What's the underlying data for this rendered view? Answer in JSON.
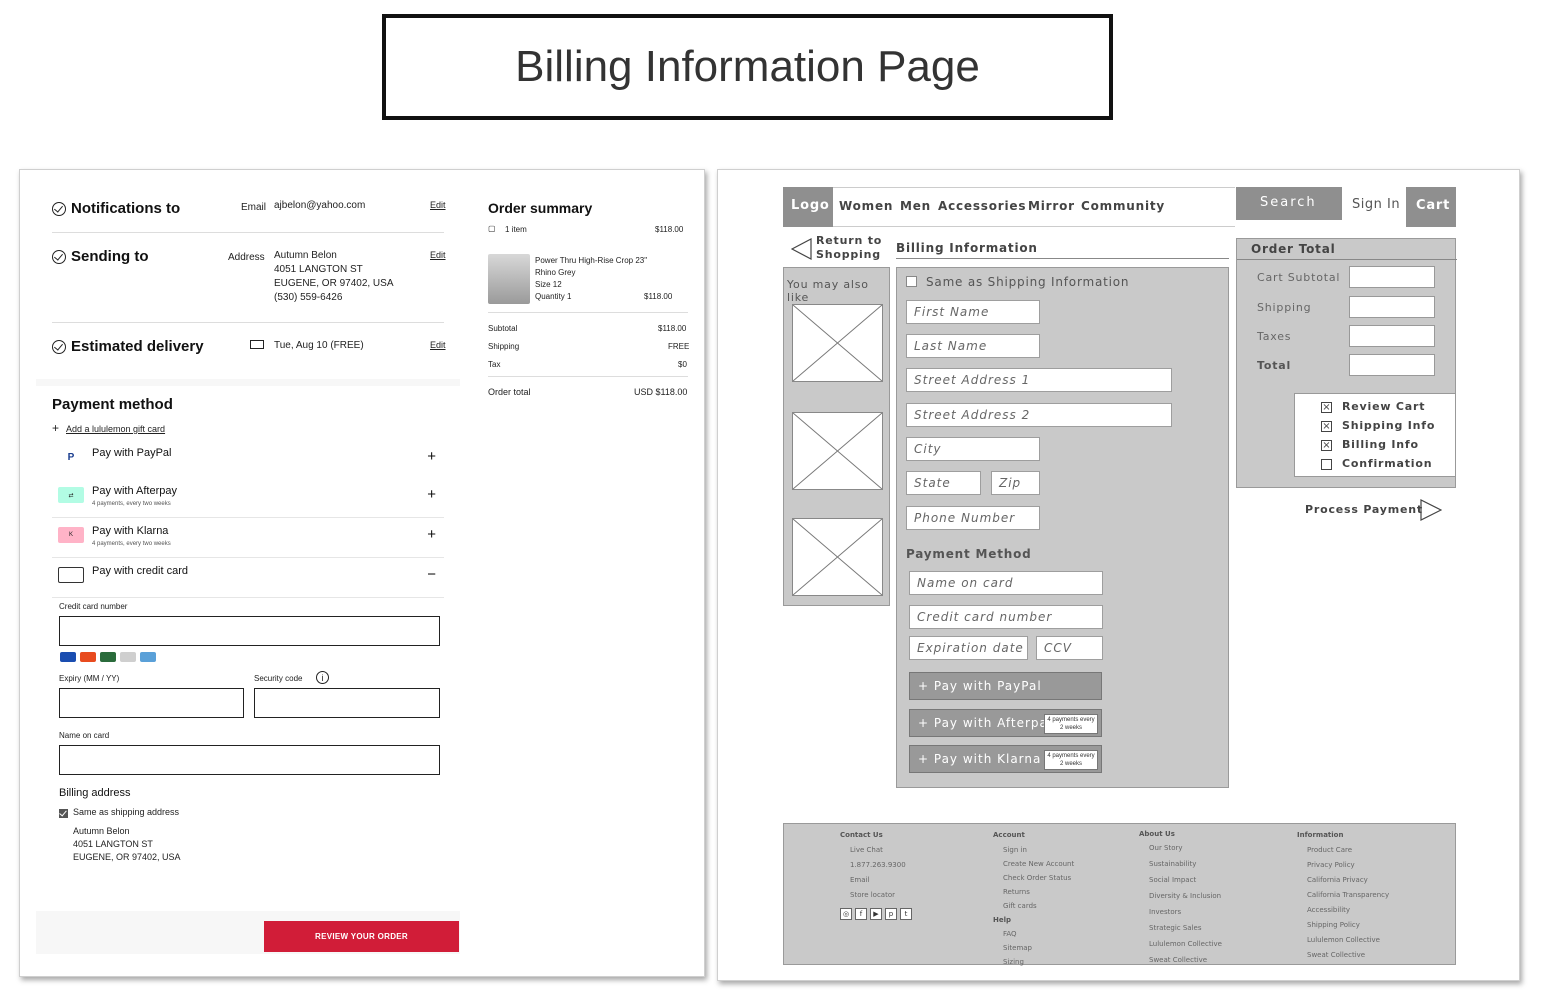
{
  "page_title": "Billing Information Page",
  "left": {
    "notifications": {
      "title": "Notifications to",
      "label": "Email",
      "value": "ajbelon@yahoo.com",
      "edit": "Edit"
    },
    "sending": {
      "title": "Sending to",
      "label": "Address",
      "lines": [
        "Autumn Belon",
        "4051 LANGTON ST",
        "EUGENE, OR 97402, USA",
        "(530) 559-6426"
      ],
      "edit": "Edit"
    },
    "delivery": {
      "title": "Estimated delivery",
      "value": "Tue, Aug 10 (FREE)",
      "edit": "Edit"
    },
    "payment": {
      "title": "Payment method",
      "gift": "Add a lululemon gift card",
      "options": [
        {
          "label": "Pay with PayPal",
          "sub": "",
          "toggle": "+"
        },
        {
          "label": "Pay with Afterpay",
          "sub": "4 payments, every two weeks",
          "toggle": "+"
        },
        {
          "label": "Pay with Klarna",
          "sub": "4 payments, every two weeks",
          "toggle": "+"
        },
        {
          "label": "Pay with credit card",
          "sub": "",
          "toggle": "−"
        }
      ],
      "cc_label": "Credit card number",
      "expiry_label": "Expiry (MM / YY)",
      "security_label": "Security code",
      "name_label": "Name on card"
    },
    "billing": {
      "title": "Billing address",
      "same": "Same as shipping address",
      "lines": [
        "Autumn Belon",
        "4051 LANGTON ST",
        "EUGENE, OR 97402, USA"
      ]
    },
    "review_button": "REVIEW YOUR ORDER",
    "order_summary": {
      "title": "Order summary",
      "items_count": "1 item",
      "total_top": "$118.00",
      "item": {
        "name": "Power Thru High-Rise Crop 23\"",
        "color": "Rhino Grey",
        "size": "Size 12",
        "qty": "Quantity 1",
        "price": "$118.00"
      },
      "rows": [
        {
          "label": "Subtotal",
          "value": "$118.00"
        },
        {
          "label": "Shipping",
          "value": "FREE"
        },
        {
          "label": "Tax",
          "value": "$0"
        }
      ],
      "order_total_label": "Order total",
      "order_total_value": "USD $118.00"
    }
  },
  "right": {
    "nav": {
      "logo": "Logo",
      "links": [
        "Women",
        "Men",
        "Accessories",
        "Mirror",
        "Community"
      ],
      "search": "Search",
      "signin": "Sign In",
      "cart": "Cart"
    },
    "return": [
      "Return to",
      "Shopping"
    ],
    "billing_header": "Billing Information",
    "also_like": "You may also like",
    "same_shipping": "Same as Shipping Information",
    "fields": {
      "first": "First Name",
      "last": "Last Name",
      "street1": "Street Address 1",
      "street2": "Street Address 2",
      "city": "City",
      "state": "State",
      "zip": "Zip",
      "phone": "Phone Number"
    },
    "payment_method": "Payment Method",
    "pay_fields": {
      "name": "Name on card",
      "cc": "Credit card number",
      "exp": "Expiration date",
      "ccv": "CCV"
    },
    "pay_buttons": [
      {
        "label": "+ Pay with PayPal",
        "tag": ""
      },
      {
        "label": "+ Pay with Afterpay",
        "tag": "4 payments every 2 weeks"
      },
      {
        "label": "+ Pay with Klarna",
        "tag": "4 payments every 2 weeks"
      }
    ],
    "order_total": {
      "title": "Order Total",
      "rows": [
        "Cart Subtotal",
        "Shipping",
        "Taxes",
        "Total"
      ]
    },
    "steps": [
      {
        "label": "Review Cart",
        "checked": true
      },
      {
        "label": "Shipping Info",
        "checked": true
      },
      {
        "label": "Billing Info",
        "checked": true
      },
      {
        "label": "Confirmation",
        "checked": false
      }
    ],
    "process_payment": "Process Payment",
    "footer": {
      "contact": {
        "title": "Contact Us",
        "items": [
          "Live Chat",
          "1.877.263.9300",
          "Email",
          "Store locator"
        ]
      },
      "account": {
        "title": "Account",
        "items": [
          "Sign in",
          "Create New Account",
          "Check Order Status",
          "Returns",
          "Gift cards"
        ]
      },
      "help": {
        "title": "Help",
        "items": [
          "FAQ",
          "Sitemap",
          "Sizing"
        ]
      },
      "about": {
        "title": "About Us",
        "items": [
          "Our Story",
          "Sustainability",
          "Social Impact",
          "Diversity & Inclusion",
          "Investors",
          "Strategic Sales",
          "Lululemon Collective",
          "Sweat Collective"
        ]
      },
      "info": {
        "title": "Information",
        "items": [
          "Product Care",
          "Privacy Policy",
          "California Privacy",
          "California Transparency",
          "Accessibility",
          "Shipping Policy",
          "Lululemon Collective",
          "Sweat Collective"
        ]
      }
    }
  }
}
